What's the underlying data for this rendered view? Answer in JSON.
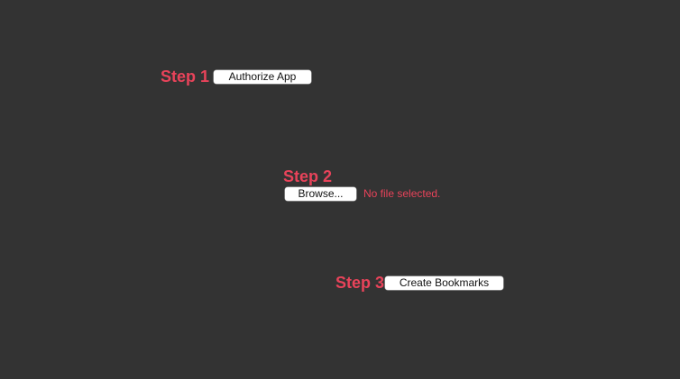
{
  "step1": {
    "label": "Step 1",
    "button_label": "Authorize App"
  },
  "step2": {
    "label": "Step 2",
    "browse_label": "Browse...",
    "file_status": "No file selected."
  },
  "step3": {
    "label": "Step 3",
    "button_label": "Create Bookmarks"
  },
  "colors": {
    "background": "#333333",
    "accent": "#e8435a",
    "button_bg": "#ffffff"
  }
}
